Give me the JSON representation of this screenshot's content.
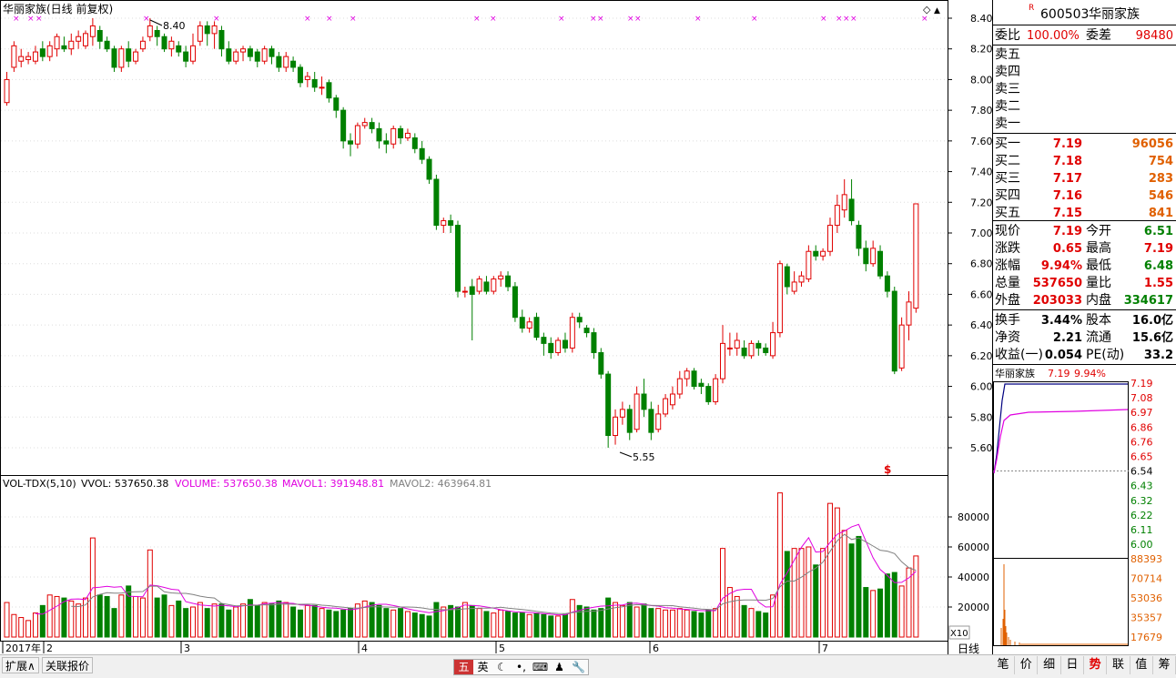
{
  "chart_title": "华丽家族(日线 前复权)",
  "chart_title_color": "#000000",
  "price_high_marker": "8.40",
  "price_low_marker": "5.55",
  "dollar_mark": "$",
  "vol_indicator": {
    "name": "VOL-TDX(5,10)",
    "vvol": "VVOL: 537650.38",
    "volume": "VOLUME: 537650.38",
    "mavol1": "MAVOL1: 391948.81",
    "mavol2": "MAVOL2: 463964.81"
  },
  "x_labels": [
    "2017年",
    "2",
    "3",
    "4",
    "5",
    "6",
    "7"
  ],
  "price_axis": [
    "8.40",
    "8.20",
    "8.00",
    "7.80",
    "7.60",
    "7.40",
    "7.20",
    "7.00",
    "6.80",
    "6.60",
    "6.40",
    "6.20",
    "6.00",
    "5.80",
    "5.60"
  ],
  "volume_axis": [
    "80000",
    "60000",
    "40000",
    "20000"
  ],
  "volume_unit": "X10",
  "period_label": "日线",
  "stock": {
    "code": "600503",
    "name": "华丽家族",
    "r_mark": "R"
  },
  "order_book": {
    "ratio_label": "委比",
    "ratio_value": "100.00%",
    "diff_label": "委差",
    "diff_value": "98480",
    "sells": [
      {
        "label": "卖五",
        "price": "",
        "vol": ""
      },
      {
        "label": "卖四",
        "price": "",
        "vol": ""
      },
      {
        "label": "卖三",
        "price": "",
        "vol": ""
      },
      {
        "label": "卖二",
        "price": "",
        "vol": ""
      },
      {
        "label": "卖一",
        "price": "",
        "vol": ""
      }
    ],
    "buys": [
      {
        "label": "买一",
        "price": "7.19",
        "vol": "96056"
      },
      {
        "label": "买二",
        "price": "7.18",
        "vol": "754"
      },
      {
        "label": "买三",
        "price": "7.17",
        "vol": "283"
      },
      {
        "label": "买四",
        "price": "7.16",
        "vol": "546"
      },
      {
        "label": "买五",
        "price": "7.15",
        "vol": "841"
      }
    ]
  },
  "quote": [
    {
      "l1": "现价",
      "v1": "7.19",
      "c1": "#e00000",
      "l2": "今开",
      "v2": "6.51",
      "c2": "#008000"
    },
    {
      "l1": "涨跌",
      "v1": "0.65",
      "c1": "#e00000",
      "l2": "最高",
      "v2": "7.19",
      "c2": "#e00000"
    },
    {
      "l1": "涨幅",
      "v1": "9.94%",
      "c1": "#e00000",
      "l2": "最低",
      "v2": "6.48",
      "c2": "#008000"
    },
    {
      "l1": "总量",
      "v1": "537650",
      "c1": "#e00000",
      "l2": "量比",
      "v2": "1.55",
      "c2": "#e00000"
    },
    {
      "l1": "外盘",
      "v1": "203033",
      "c1": "#e00000",
      "l2": "内盘",
      "v2": "334617",
      "c2": "#008000"
    }
  ],
  "fundamentals": [
    {
      "l1": "换手",
      "v1": "3.44%",
      "l2": "股本",
      "v2": "16.0亿"
    },
    {
      "l1": "净资",
      "v1": "2.21",
      "l2": "流通",
      "v2": "15.6亿"
    },
    {
      "l1": "收益(一)",
      "v1": "0.054",
      "l2": "PE(动)",
      "v2": "33.2"
    }
  ],
  "mini_chart": {
    "name": "华丽家族",
    "price": "7.19",
    "pct": "9.94%",
    "price_axis": [
      "7.19",
      "7.08",
      "6.97",
      "6.86",
      "6.76",
      "6.65",
      "6.54",
      "6.43",
      "6.32",
      "6.22",
      "6.11",
      "6.00"
    ],
    "vol_axis": [
      "88393",
      "70714",
      "53036",
      "35357",
      "17679"
    ]
  },
  "bottom_left": {
    "expand": "扩展∧",
    "related": "关联报价"
  },
  "ime_items": [
    "五",
    "英",
    "☾",
    "•,",
    "⌨",
    "♟",
    "🔧"
  ],
  "right_tabs": [
    "笔",
    "价",
    "细",
    "日",
    "势",
    "联",
    "值",
    "筹"
  ],
  "active_tab_index": 4,
  "colors": {
    "up": "#e00000",
    "down": "#008000",
    "ma_pink": "#e000e0",
    "ma_gray": "#808080",
    "mini_line": "#000080",
    "mini_avg": "#e000e0",
    "mini_vol": "#e06000"
  },
  "chart_data": {
    "type": "candlestick",
    "title": "华丽家族(日线 前复权)",
    "ylim": [
      5.45,
      8.5
    ],
    "candles": [
      [
        7.85,
        8.0,
        8.05,
        7.83
      ],
      [
        8.08,
        8.22,
        8.25,
        8.05
      ],
      [
        8.12,
        8.15,
        8.2,
        8.08
      ],
      [
        8.13,
        8.15,
        8.18,
        8.1
      ],
      [
        8.12,
        8.18,
        8.22,
        8.1
      ],
      [
        8.2,
        8.15,
        8.25,
        8.12
      ],
      [
        8.15,
        8.22,
        8.25,
        8.12
      ],
      [
        8.2,
        8.28,
        8.3,
        8.15
      ],
      [
        8.22,
        8.2,
        8.28,
        8.18
      ],
      [
        8.2,
        8.25,
        8.3,
        8.16
      ],
      [
        8.25,
        8.28,
        8.32,
        8.2
      ],
      [
        8.22,
        8.3,
        8.32,
        8.2
      ],
      [
        8.28,
        8.35,
        8.4,
        8.22
      ],
      [
        8.32,
        8.25,
        8.35,
        8.2
      ],
      [
        8.25,
        8.2,
        8.28,
        8.18
      ],
      [
        8.2,
        8.08,
        8.22,
        8.05
      ],
      [
        8.08,
        8.2,
        8.22,
        8.05
      ],
      [
        8.2,
        8.12,
        8.25,
        8.08
      ],
      [
        8.12,
        8.18,
        8.2,
        8.1
      ],
      [
        8.2,
        8.25,
        8.28,
        8.18
      ],
      [
        8.28,
        8.35,
        8.4,
        8.25
      ],
      [
        8.32,
        8.28,
        8.35,
        8.22
      ],
      [
        8.28,
        8.2,
        8.3,
        8.18
      ],
      [
        8.2,
        8.25,
        8.28,
        8.15
      ],
      [
        8.22,
        8.18,
        8.25,
        8.15
      ],
      [
        8.18,
        8.12,
        8.22,
        8.08
      ],
      [
        8.12,
        8.22,
        8.3,
        8.1
      ],
      [
        8.25,
        8.35,
        8.38,
        8.22
      ],
      [
        8.35,
        8.3,
        8.38,
        8.22
      ],
      [
        8.3,
        8.35,
        8.38,
        8.2
      ],
      [
        8.32,
        8.2,
        8.35,
        8.15
      ],
      [
        8.2,
        8.12,
        8.25,
        8.1
      ],
      [
        8.12,
        8.18,
        8.2,
        8.1
      ],
      [
        8.18,
        8.2,
        8.22,
        8.12
      ],
      [
        8.2,
        8.15,
        8.22,
        8.12
      ],
      [
        8.18,
        8.12,
        8.2,
        8.08
      ],
      [
        8.12,
        8.2,
        8.22,
        8.1
      ],
      [
        8.2,
        8.15,
        8.22,
        8.1
      ],
      [
        8.15,
        8.08,
        8.18,
        8.05
      ],
      [
        8.08,
        8.15,
        8.18,
        8.05
      ],
      [
        8.12,
        8.08,
        8.15,
        8.05
      ],
      [
        8.08,
        7.98,
        8.1,
        7.95
      ],
      [
        8.0,
        8.02,
        8.05,
        7.95
      ],
      [
        8.0,
        7.95,
        8.05,
        7.92
      ],
      [
        7.95,
        7.95,
        8.02,
        7.9
      ],
      [
        7.98,
        7.88,
        8.0,
        7.85
      ],
      [
        7.88,
        7.8,
        7.9,
        7.75
      ],
      [
        7.8,
        7.6,
        7.82,
        7.55
      ],
      [
        7.6,
        7.58,
        7.65,
        7.5
      ],
      [
        7.58,
        7.7,
        7.72,
        7.55
      ],
      [
        7.7,
        7.72,
        7.75,
        7.68
      ],
      [
        7.72,
        7.68,
        7.75,
        7.65
      ],
      [
        7.68,
        7.6,
        7.72,
        7.55
      ],
      [
        7.6,
        7.58,
        7.65,
        7.52
      ],
      [
        7.58,
        7.68,
        7.7,
        7.55
      ],
      [
        7.68,
        7.62,
        7.7,
        7.58
      ],
      [
        7.62,
        7.65,
        7.68,
        7.6
      ],
      [
        7.62,
        7.55,
        7.65,
        7.52
      ],
      [
        7.55,
        7.48,
        7.6,
        7.45
      ],
      [
        7.48,
        7.35,
        7.5,
        7.32
      ],
      [
        7.35,
        7.05,
        7.38,
        7.02
      ],
      [
        7.05,
        7.08,
        7.1,
        7.0
      ],
      [
        7.08,
        7.05,
        7.12,
        7.0
      ],
      [
        7.05,
        6.62,
        7.08,
        6.58
      ],
      [
        6.62,
        6.62,
        6.65,
        6.58
      ],
      [
        6.65,
        6.6,
        6.7,
        6.3
      ],
      [
        6.62,
        6.7,
        6.72,
        6.6
      ],
      [
        6.68,
        6.62,
        6.72,
        6.6
      ],
      [
        6.62,
        6.7,
        6.72,
        6.6
      ],
      [
        6.7,
        6.72,
        6.75,
        6.65
      ],
      [
        6.72,
        6.65,
        6.75,
        6.62
      ],
      [
        6.65,
        6.45,
        6.68,
        6.42
      ],
      [
        6.45,
        6.38,
        6.5,
        6.35
      ],
      [
        6.38,
        6.42,
        6.45,
        6.35
      ],
      [
        6.45,
        6.32,
        6.48,
        6.3
      ],
      [
        6.32,
        6.28,
        6.35,
        6.2
      ],
      [
        6.28,
        6.22,
        6.32,
        6.18
      ],
      [
        6.22,
        6.3,
        6.32,
        6.2
      ],
      [
        6.3,
        6.25,
        6.35,
        6.22
      ],
      [
        6.25,
        6.45,
        6.48,
        6.22
      ],
      [
        6.45,
        6.42,
        6.48,
        6.38
      ],
      [
        6.38,
        6.35,
        6.4,
        6.32
      ],
      [
        6.35,
        6.22,
        6.38,
        6.18
      ],
      [
        6.22,
        6.08,
        6.25,
        6.05
      ],
      [
        6.08,
        5.68,
        6.1,
        5.6
      ],
      [
        5.68,
        5.8,
        5.85,
        5.62
      ],
      [
        5.8,
        5.85,
        5.9,
        5.75
      ],
      [
        5.85,
        5.7,
        5.88,
        5.65
      ],
      [
        5.72,
        5.95,
        6.0,
        5.7
      ],
      [
        5.95,
        5.85,
        6.05,
        5.8
      ],
      [
        5.85,
        5.7,
        5.9,
        5.65
      ],
      [
        5.72,
        5.82,
        5.88,
        5.7
      ],
      [
        5.82,
        5.92,
        5.95,
        5.8
      ],
      [
        5.88,
        5.95,
        6.0,
        5.85
      ],
      [
        5.95,
        6.05,
        6.1,
        5.92
      ],
      [
        6.05,
        6.1,
        6.12,
        6.0
      ],
      [
        6.1,
        6.0,
        6.12,
        5.98
      ],
      [
        6.02,
        6.0,
        6.05,
        5.95
      ],
      [
        6.0,
        5.9,
        6.02,
        5.88
      ],
      [
        5.9,
        6.05,
        6.08,
        5.88
      ],
      [
        6.05,
        6.28,
        6.4,
        6.02
      ],
      [
        6.25,
        6.25,
        6.35,
        6.2
      ],
      [
        6.25,
        6.3,
        6.35,
        6.2
      ],
      [
        6.25,
        6.2,
        6.3,
        6.18
      ],
      [
        6.2,
        6.28,
        6.3,
        6.18
      ],
      [
        6.28,
        6.25,
        6.3,
        6.2
      ],
      [
        6.25,
        6.22,
        6.28,
        6.2
      ],
      [
        6.2,
        6.35,
        6.42,
        6.18
      ],
      [
        6.35,
        6.8,
        6.82,
        6.32
      ],
      [
        6.78,
        6.65,
        6.8,
        6.6
      ],
      [
        6.62,
        6.68,
        6.75,
        6.6
      ],
      [
        6.68,
        6.72,
        6.75,
        6.65
      ],
      [
        6.7,
        6.88,
        6.92,
        6.68
      ],
      [
        6.88,
        6.85,
        6.92,
        6.82
      ],
      [
        6.85,
        6.88,
        6.9,
        6.82
      ],
      [
        6.88,
        7.05,
        7.1,
        6.85
      ],
      [
        7.05,
        7.18,
        7.25,
        7.0
      ],
      [
        7.15,
        7.25,
        7.35,
        7.1
      ],
      [
        7.22,
        7.08,
        7.35,
        7.05
      ],
      [
        7.05,
        6.9,
        7.08,
        6.85
      ],
      [
        6.9,
        6.8,
        6.95,
        6.75
      ],
      [
        6.8,
        6.9,
        6.95,
        6.78
      ],
      [
        6.88,
        6.72,
        6.92,
        6.7
      ],
      [
        6.72,
        6.62,
        6.75,
        6.58
      ],
      [
        6.62,
        6.1,
        6.65,
        6.08
      ],
      [
        6.12,
        6.4,
        6.45,
        6.1
      ],
      [
        6.4,
        6.55,
        6.62,
        6.3
      ],
      [
        6.51,
        7.19,
        7.19,
        6.48
      ]
    ],
    "volumes": [
      2.3,
      1.5,
      1.3,
      1.1,
      1.6,
      2.1,
      2.8,
      2.7,
      2.6,
      2.4,
      2.2,
      2.6,
      6.6,
      2.8,
      2.7,
      1.9,
      2.8,
      3.4,
      2.7,
      2.6,
      5.8,
      2.6,
      2.8,
      2.1,
      2.4,
      1.9,
      2.0,
      2.3,
      1.9,
      2.2,
      2.2,
      1.8,
      2.0,
      2.2,
      2.5,
      2.1,
      2.3,
      2.2,
      2.4,
      2.3,
      2.0,
      1.8,
      2.1,
      2.1,
      1.9,
      1.8,
      1.7,
      1.8,
      1.9,
      2.2,
      2.4,
      2.3,
      2.1,
      1.9,
      1.8,
      1.9,
      1.7,
      1.6,
      1.5,
      1.4,
      2.3,
      2.0,
      2.1,
      2.0,
      2.3,
      2.1,
      1.9,
      1.7,
      1.6,
      1.8,
      1.7,
      1.6,
      1.6,
      1.5,
      1.6,
      1.5,
      1.4,
      1.4,
      1.5,
      2.5,
      2.1,
      2.0,
      1.8,
      1.9,
      2.6,
      2.3,
      2.1,
      2.3,
      2.0,
      2.2,
      1.9,
      1.9,
      1.8,
      1.8,
      1.9,
      1.8,
      1.7,
      1.6,
      1.8,
      1.9,
      5.9,
      3.3,
      2.7,
      2.1,
      1.9,
      1.7,
      1.6,
      2.8,
      9.6,
      5.7,
      5.9,
      5.9,
      6.0,
      4.8,
      5.9,
      8.9,
      8.6,
      7.1,
      6.2,
      6.7,
      3.3,
      3.1,
      3.2,
      4.2,
      4.3,
      3.4,
      4.6,
      5.4
    ]
  }
}
